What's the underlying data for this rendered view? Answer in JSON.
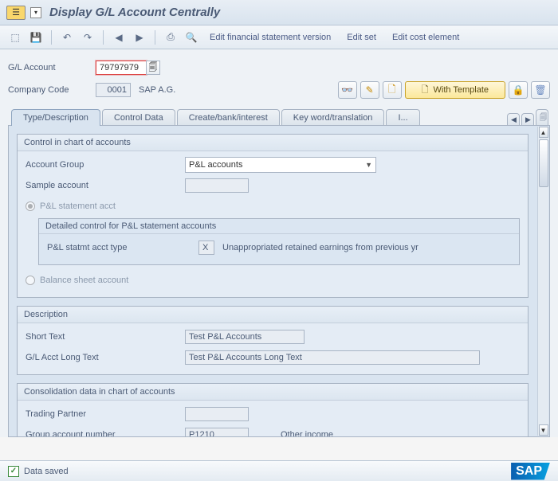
{
  "title": "Display G/L Account Centrally",
  "toolbar": {
    "edit_fin": "Edit financial statement version",
    "edit_set": "Edit set",
    "edit_cost": "Edit cost element"
  },
  "header": {
    "gl_account_label": "G/L Account",
    "gl_account_value": "79797979",
    "company_code_label": "Company Code",
    "company_code_value": "0001",
    "company_name": "SAP A.G.",
    "with_template": "With Template"
  },
  "tabs": {
    "t1": "Type/Description",
    "t2": "Control Data",
    "t3": "Create/bank/interest",
    "t4": "Key word/translation",
    "t5": "I..."
  },
  "coa": {
    "title": "Control in chart of accounts",
    "account_group_label": "Account Group",
    "account_group_value": "P&L accounts",
    "sample_account_label": "Sample account",
    "sample_account_value": "",
    "pl_radio": "P&L statement acct",
    "detailed_title": "Detailed control for P&L statement accounts",
    "pl_type_label": "P&L statmt acct type",
    "pl_type_value": "X",
    "pl_type_desc": "Unappropriated retained earnings from previous yr",
    "bs_radio": "Balance sheet account"
  },
  "desc": {
    "title": "Description",
    "short_label": "Short Text",
    "short_value": "Test P&L Accounts",
    "long_label": "G/L Acct Long Text",
    "long_value": "Test P&L Accounts Long Text"
  },
  "cons": {
    "title": "Consolidation data in chart of accounts",
    "trading_label": "Trading Partner",
    "trading_value": "",
    "group_label": "Group account number",
    "group_value": "P1210",
    "group_desc": "Other income"
  },
  "status": {
    "message": "Data saved"
  },
  "logo": "SAP"
}
